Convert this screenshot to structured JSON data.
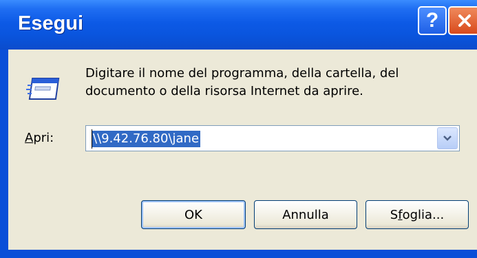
{
  "window": {
    "title": "Esegui",
    "help_label": "?",
    "close_icon": "close-icon"
  },
  "dialog": {
    "description_line1": "Digitare il nome del programma, della cartella, del",
    "description_line2": "documento o della risorsa Internet da aprire.",
    "icon": "run-icon"
  },
  "open_field": {
    "label_accel": "A",
    "label_rest": "pri:",
    "value": "\\\\9.42.76.80\\jane",
    "dropdown_icon": "chevron-down-icon"
  },
  "buttons": {
    "ok": "OK",
    "cancel": "Annulla",
    "browse_pre": "S",
    "browse_accel": "f",
    "browse_post": "oglia..."
  },
  "colors": {
    "titlebar": "#0a55de",
    "client": "#ece9d8",
    "selection": "#316ac5",
    "close_button": "#d84a1c"
  }
}
